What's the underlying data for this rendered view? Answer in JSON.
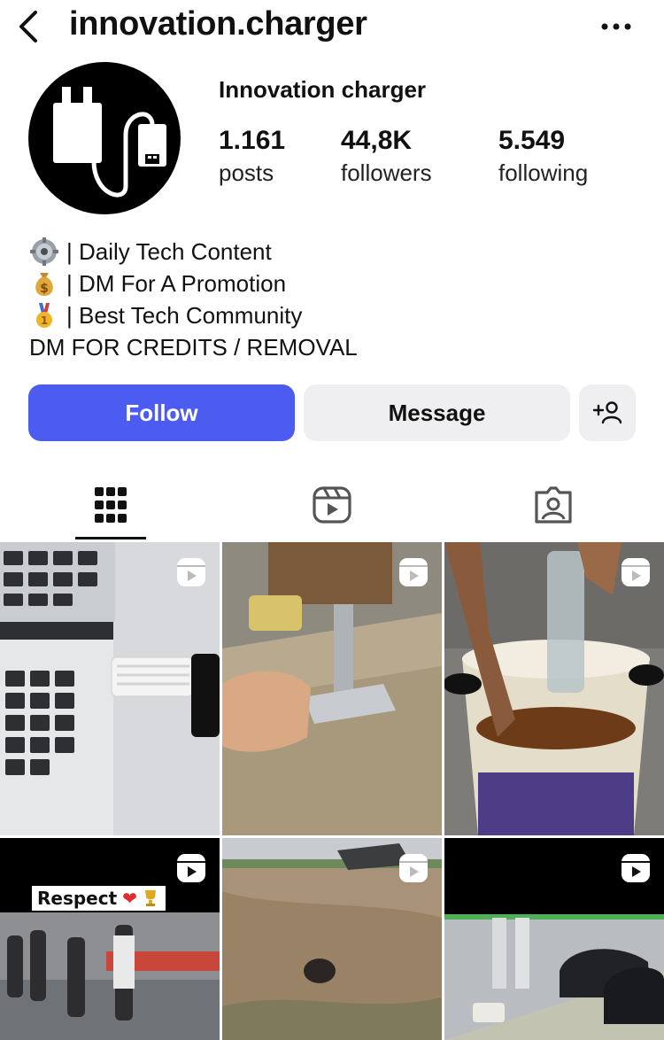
{
  "header": {
    "username": "innovation.charger"
  },
  "profile": {
    "display_name": "Innovation charger",
    "stats": [
      {
        "value": "1.161",
        "label": "posts"
      },
      {
        "value": "44,8K",
        "label": "followers"
      },
      {
        "value": "5.549",
        "label": "following"
      }
    ],
    "bio": [
      {
        "emoji": "gear-icon",
        "text": "| Daily Tech Content"
      },
      {
        "emoji": "money-bag-icon",
        "text": "| DM For A Promotion"
      },
      {
        "emoji": "medal-icon",
        "text": "| Best Tech Community"
      },
      {
        "emoji": "",
        "text": "DM FOR CREDITS / REMOVAL"
      }
    ]
  },
  "actions": {
    "follow_label": "Follow",
    "message_label": "Message"
  },
  "tabs": [
    {
      "icon": "grid-icon",
      "selected": true
    },
    {
      "icon": "reels-icon",
      "selected": false
    },
    {
      "icon": "tagged-icon",
      "selected": false
    }
  ],
  "posts": [
    {
      "type": "reel",
      "caption": ""
    },
    {
      "type": "reel",
      "caption": ""
    },
    {
      "type": "reel",
      "caption": ""
    },
    {
      "type": "reel",
      "caption": "Respect"
    },
    {
      "type": "reel",
      "caption": ""
    },
    {
      "type": "reel",
      "caption": ""
    }
  ],
  "colors": {
    "accent": "#4c5cf0",
    "secondary_button": "#efeff1"
  }
}
